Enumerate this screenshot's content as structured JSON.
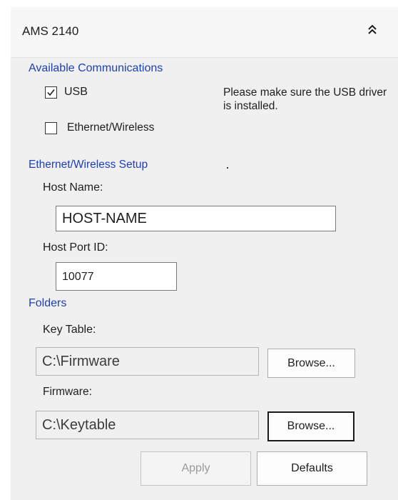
{
  "header": {
    "title": "AMS 2140",
    "collapse_icon": "double-chevron-up-icon"
  },
  "communications": {
    "title": "Available Communications",
    "usb_label": "USB",
    "usb_checked": true,
    "ethernet_label": "Ethernet/Wireless",
    "ethernet_checked": false,
    "note": "Please make sure the USB driver is installed."
  },
  "ethernet_setup": {
    "title": "Ethernet/Wireless Setup",
    "host_name_label": "Host Name:",
    "host_name_value": "HOST-NAME",
    "host_port_label": "Host Port ID:",
    "host_port_value": "10077"
  },
  "folders": {
    "title": "Folders",
    "key_table_label": "Key Table:",
    "key_table_value": "C:\\Firmware",
    "key_table_browse": "Browse...",
    "firmware_label": "Firmware:",
    "firmware_value": "C:\\Keytable",
    "firmware_browse": "Browse..."
  },
  "actions": {
    "apply_label": "Apply",
    "defaults_label": "Defaults"
  },
  "colors": {
    "section_title": "#1d3fb8",
    "panel_background": "#f0f0f0"
  }
}
